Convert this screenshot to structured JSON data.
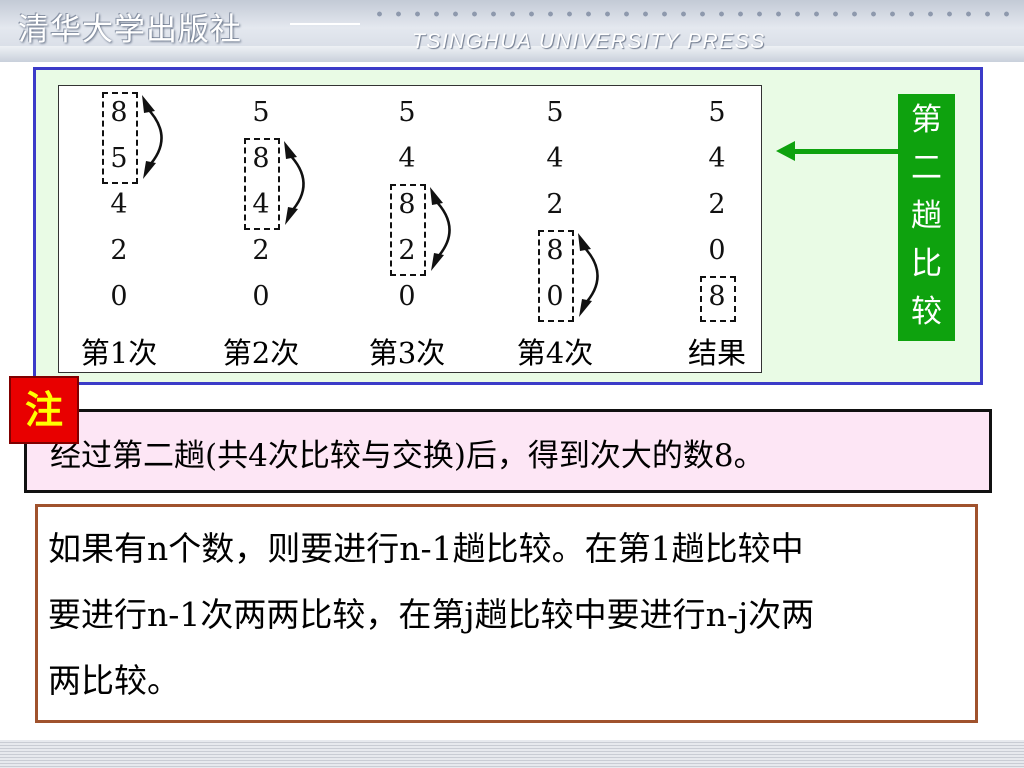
{
  "header": {
    "publisher_cn": "清华大学出版社",
    "publisher_en": "TSINGHUA UNIVERSITY PRESS"
  },
  "diagram": {
    "columns": [
      {
        "label": "第1次",
        "values": [
          "8",
          "5",
          "4",
          "2",
          "0"
        ],
        "boxed": [
          0,
          1
        ],
        "swap_arrow": true
      },
      {
        "label": "第2次",
        "values": [
          "5",
          "8",
          "4",
          "2",
          "0"
        ],
        "boxed": [
          1,
          2
        ],
        "swap_arrow": true
      },
      {
        "label": "第3次",
        "values": [
          "5",
          "4",
          "8",
          "2",
          "0"
        ],
        "boxed": [
          2,
          3
        ],
        "swap_arrow": true
      },
      {
        "label": "第4次",
        "values": [
          "5",
          "4",
          "2",
          "8",
          "0"
        ],
        "boxed": [
          3,
          4
        ],
        "swap_arrow": true
      },
      {
        "label": "结果",
        "values": [
          "5",
          "4",
          "2",
          "0",
          "8"
        ],
        "boxed": [
          4
        ],
        "swap_arrow": false
      }
    ],
    "side_label": [
      "第",
      "二",
      "趟",
      "比",
      "较"
    ],
    "colors": {
      "frame": "#3b3bc8",
      "frame_fill": "#e9fbe5",
      "side_tag": "#0ea20e"
    }
  },
  "note": {
    "badge": "注",
    "text": "经过第二趟(共4次比较与交换)后，得到次大的数8。"
  },
  "paragraph": {
    "lines": [
      "如果有n个数，则要进行n-1趟比较。在第1趟比较中",
      "要进行n-1次两两比较，在第j趟比较中要进行n-j次两",
      "两比较。"
    ]
  }
}
